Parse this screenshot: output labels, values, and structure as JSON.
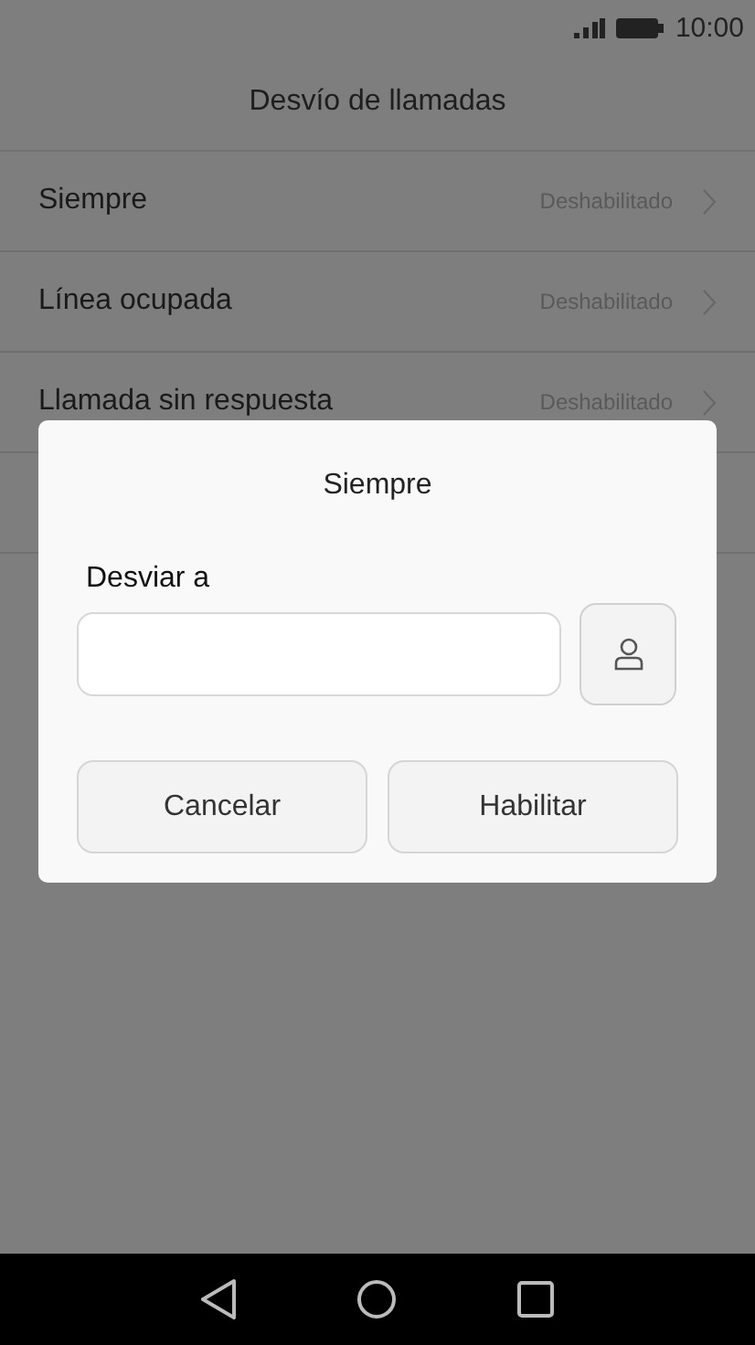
{
  "status_bar": {
    "time": "10:00"
  },
  "title": "Desvío de llamadas",
  "rows": [
    {
      "label": "Siempre",
      "value": "Deshabilitado"
    },
    {
      "label": "Línea ocupada",
      "value": "Deshabilitado"
    },
    {
      "label": "Llamada sin respuesta",
      "value": "Deshabilitado"
    }
  ],
  "dialog": {
    "title": "Siempre",
    "field_label": "Desviar a",
    "buttons": [
      "Cancelar",
      "Habilitar"
    ]
  }
}
